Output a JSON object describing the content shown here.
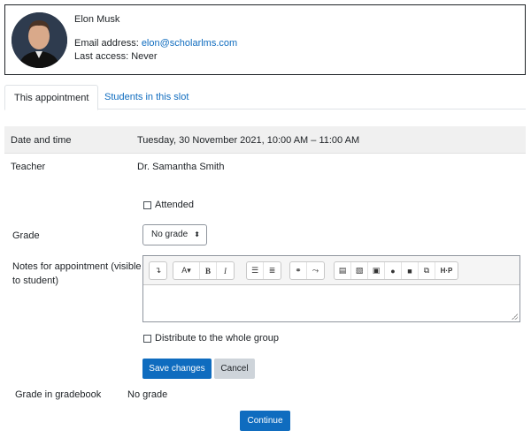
{
  "user": {
    "name": "Elon Musk",
    "email_label": "Email address: ",
    "email": "elon@scholarlms.com",
    "access_label": "Last access: ",
    "access": "Never"
  },
  "tabs": [
    {
      "label": "This appointment",
      "active": true
    },
    {
      "label": "Students in this slot",
      "active": false
    }
  ],
  "details": {
    "date_label": "Date and time",
    "date_value": "Tuesday, 30 November 2021, 10:00 AM – 11:00 AM",
    "teacher_label": "Teacher",
    "teacher_value": "Dr. Samantha Smith"
  },
  "form": {
    "attended_label": "Attended",
    "grade_label": "Grade",
    "grade_value": "No grade",
    "notes_label_line1": "Notes for appointment (visible",
    "notes_label_line2": "to student)",
    "distribute_label": "Distribute to the whole group",
    "save_label": "Save changes",
    "cancel_label": "Cancel"
  },
  "toolbar": {
    "icons": [
      "paragraph-direction-icon",
      "font-color-icon",
      "bold-icon",
      "italic-icon",
      "bullet-list-icon",
      "numbered-list-icon",
      "link-icon",
      "unlink-icon",
      "word-import-icon",
      "image-icon",
      "media-icon",
      "record-audio-icon",
      "record-video-icon",
      "copy-icon",
      "h5p-icon"
    ],
    "bold_glyph": "B",
    "italic_glyph": "I",
    "h5p_glyph": "H·P"
  },
  "gradebook": {
    "label": "Grade in gradebook",
    "value": "No grade"
  },
  "continue_label": "Continue",
  "colors": {
    "accent": "#0f6cbf",
    "text": "#1d2125",
    "band": "#f0f0f0"
  }
}
